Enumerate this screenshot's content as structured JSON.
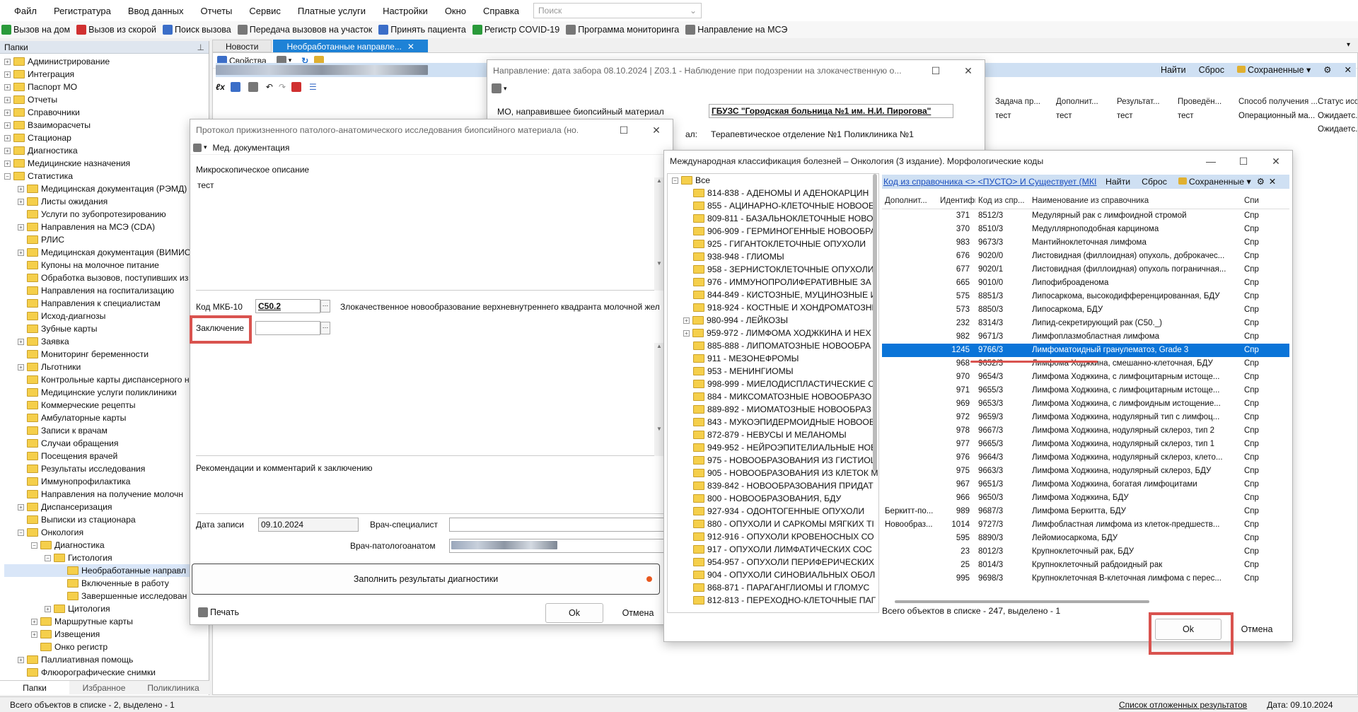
{
  "menu": [
    "Файл",
    "Регистратура",
    "Ввод данных",
    "Отчеты",
    "Сервис",
    "Платные услуги",
    "Настройки",
    "Окно",
    "Справка"
  ],
  "search": {
    "placeholder": "Поиск"
  },
  "toolbar": [
    {
      "label": "Вызов на дом",
      "icon": "home-call-icon",
      "color": "g"
    },
    {
      "label": "Вызов из скорой",
      "icon": "ambulance-call-icon",
      "color": "r"
    },
    {
      "label": "Поиск вызова",
      "icon": "search-call-icon",
      "color": "b"
    },
    {
      "label": "Передача вызовов на участок",
      "icon": "transfer-icon",
      "color": "gr"
    },
    {
      "label": "Принять пациента",
      "icon": "patient-icon",
      "color": "b"
    },
    {
      "label": "Регистр COVID-19",
      "icon": "covid-icon",
      "color": "g"
    },
    {
      "label": "Программа мониторинга",
      "icon": "monitoring-icon",
      "color": "gr"
    },
    {
      "label": "Направление на МСЭ",
      "icon": "mse-icon",
      "color": "gr"
    }
  ],
  "left": {
    "title": "Папки",
    "tree": [
      {
        "label": "Администрирование",
        "lvl": 0,
        "exp": "+"
      },
      {
        "label": "Интеграция",
        "lvl": 0,
        "exp": "+"
      },
      {
        "label": "Паспорт МО",
        "lvl": 0,
        "exp": "+"
      },
      {
        "label": "Отчеты",
        "lvl": 0,
        "exp": "+"
      },
      {
        "label": "Справочники",
        "lvl": 0,
        "exp": "+"
      },
      {
        "label": "Взаиморасчеты",
        "lvl": 0,
        "exp": "+"
      },
      {
        "label": "Стационар",
        "lvl": 0,
        "exp": "+"
      },
      {
        "label": "Диагностика",
        "lvl": 0,
        "exp": "+"
      },
      {
        "label": "Медицинские назначения",
        "lvl": 0,
        "exp": "+"
      },
      {
        "label": "Статистика",
        "lvl": 0,
        "exp": "−"
      },
      {
        "label": "Медицинская документация (РЭМД)",
        "lvl": 1,
        "exp": "+"
      },
      {
        "label": "Листы ожидания",
        "lvl": 1,
        "exp": "+"
      },
      {
        "label": "Услуги по зубопротезированию",
        "lvl": 1,
        "exp": ""
      },
      {
        "label": "Направления на МСЭ (CDA)",
        "lvl": 1,
        "exp": "+"
      },
      {
        "label": "РЛИС",
        "lvl": 1,
        "exp": ""
      },
      {
        "label": "Медицинская документация (ВИМИС)",
        "lvl": 1,
        "exp": "+"
      },
      {
        "label": "Купоны на молочное питание",
        "lvl": 1,
        "exp": ""
      },
      {
        "label": "Обработка вызовов, поступивших из",
        "lvl": 1,
        "exp": ""
      },
      {
        "label": "Направления на госпитализацию",
        "lvl": 1,
        "exp": ""
      },
      {
        "label": "Направления к специалистам",
        "lvl": 1,
        "exp": ""
      },
      {
        "label": "Исход-диагнозы",
        "lvl": 1,
        "exp": ""
      },
      {
        "label": "Зубные карты",
        "lvl": 1,
        "exp": ""
      },
      {
        "label": "Заявка",
        "lvl": 1,
        "exp": "+"
      },
      {
        "label": "Мониторинг беременности",
        "lvl": 1,
        "exp": ""
      },
      {
        "label": "Льготники",
        "lvl": 1,
        "exp": "+"
      },
      {
        "label": "Контрольные карты диспансерного н",
        "lvl": 1,
        "exp": ""
      },
      {
        "label": "Медицинские услуги поликлиники",
        "lvl": 1,
        "exp": ""
      },
      {
        "label": "Коммерческие рецепты",
        "lvl": 1,
        "exp": ""
      },
      {
        "label": "Амбулаторные карты",
        "lvl": 1,
        "exp": ""
      },
      {
        "label": "Записи к врачам",
        "lvl": 1,
        "exp": ""
      },
      {
        "label": "Случаи обращения",
        "lvl": 1,
        "exp": ""
      },
      {
        "label": "Посещения врачей",
        "lvl": 1,
        "exp": ""
      },
      {
        "label": "Результаты исследования",
        "lvl": 1,
        "exp": ""
      },
      {
        "label": "Иммунопрофилактика",
        "lvl": 1,
        "exp": ""
      },
      {
        "label": "Направления на получение молочн",
        "lvl": 1,
        "exp": ""
      },
      {
        "label": "Диспансеризация",
        "lvl": 1,
        "exp": "+"
      },
      {
        "label": "Выписки из стационара",
        "lvl": 1,
        "exp": ""
      },
      {
        "label": "Онкология",
        "lvl": 1,
        "exp": "−"
      },
      {
        "label": "Диагностика",
        "lvl": 2,
        "exp": "−"
      },
      {
        "label": "Гистология",
        "lvl": 3,
        "exp": "−"
      },
      {
        "label": "Необработанные направл",
        "lvl": 4,
        "exp": "",
        "sel": true
      },
      {
        "label": "Включенные в работу",
        "lvl": 4,
        "exp": ""
      },
      {
        "label": "Завершенные исследован",
        "lvl": 4,
        "exp": ""
      },
      {
        "label": "Цитология",
        "lvl": 3,
        "exp": "+"
      },
      {
        "label": "Маршрутные карты",
        "lvl": 2,
        "exp": "+"
      },
      {
        "label": "Извещения",
        "lvl": 2,
        "exp": "+"
      },
      {
        "label": "Онко регистр",
        "lvl": 2,
        "exp": ""
      },
      {
        "label": "Паллиативная помощь",
        "lvl": 1,
        "exp": "+"
      },
      {
        "label": "Флюорографические снимки",
        "lvl": 1,
        "exp": ""
      }
    ],
    "tabs": [
      "Папки",
      "Избранное",
      "Поликлиника"
    ]
  },
  "doc_tabs": [
    "Новости",
    "Необработанные направле..."
  ],
  "main": {
    "props_label": "Свойства",
    "find": "Найти",
    "reset": "Сброс",
    "saved": "Сохраненные",
    "right_cols": [
      "Задача пр...",
      "Дополнит...",
      "Результат...",
      "Проведён...",
      "Способ получения ...",
      "Статус исс"
    ],
    "right_rows": [
      [
        "тест",
        "тест",
        "тест",
        "тест",
        "Операционный ма...",
        "Ожидаетс."
      ],
      [
        "",
        "",
        "",
        "",
        "",
        "Ожидаетс."
      ]
    ]
  },
  "dir_win": {
    "title": "Направление: дата забора 08.10.2024 | Z03.1 - Наблюдение при подозрении на злокачественную о...",
    "mo_label": "МО, направившее биопсийный материал",
    "mo_value": "ГБУЗС \"Городская больница №1 им. Н.И. Пирогова\"",
    "dept_label": "ал:",
    "dept_value": "Терапевтическое отделение №1 Поликлиника №1"
  },
  "proto": {
    "title": "Протокол прижизненного патолого-анатомического исследования биопсийного материала (но...",
    "med_doc": "Мед. документация",
    "micro_label": "Микроскопическое описание",
    "micro_value": "тест",
    "mkb_label": "Код МКБ-10",
    "mkb_value": "C50.2",
    "mkb_desc": "Злокачественное новообразование верхневнутреннего квадранта молочной жел",
    "concl_label": "Заключение",
    "rec_label": "Рекомендации и комментарий к заключению",
    "date_label": "Дата записи",
    "date_value": "09.10.2024",
    "doc_spec_label": "Врач-специалист",
    "doc_path_label": "Врач-патологоанатом",
    "fill_btn": "Заполнить результаты диагностики",
    "print": "Печать",
    "ok": "Ok",
    "cancel": "Отмена"
  },
  "icd": {
    "title": "Международная классификация болезней – Онкология (3 издание). Морфологические коды",
    "filter": "Код из справочника <> <ПУСТО> И Существует (МКI",
    "find": "Найти",
    "reset": "Сброс",
    "saved": "Сохраненные",
    "tree_root": "Все",
    "tree": [
      "814-838 - АДЕНОМЫ И АДЕНОКАРЦИН",
      "855 - АЦИНАРНО-КЛЕТОЧНЫЕ НОВООБ",
      "809-811 - БАЗАЛЬНОКЛЕТОЧНЫЕ НОВО",
      "906-909 - ГЕРМИНОГЕННЫЕ НОВООБРА",
      "925 - ГИГАНТОКЛЕТОЧНЫЕ ОПУХОЛИ",
      "938-948 - ГЛИОМЫ",
      "958 - ЗЕРНИСТОКЛЕТОЧНЫЕ ОПУХОЛИ",
      "976 - ИММУНОПРОЛИФЕРАТИВНЫЕ ЗА",
      "844-849 - КИСТОЗНЫЕ, МУЦИНОЗНЫЕ И",
      "918-924 - КОСТНЫЕ И ХОНДРОМАТОЗНЬ",
      "980-994 - ЛЕЙКОЗЫ",
      "959-972 - ЛИМФОМА ХОДЖКИНА И НЕХ",
      "885-888 - ЛИПОМАТОЗНЫЕ НОВООБРА",
      "911 - МЕЗОНЕФРОМЫ",
      "953 - МЕНИНГИОМЫ",
      "998-999 - МИЕЛОДИСПЛАСТИЧЕСКИЕ С",
      "884 - МИКСОМАТОЗНЫЕ НОВООБРАЗО",
      "889-892 - МИОМАТОЗНЫЕ НОВООБРАЗ",
      "843 - МУКОЭПИДЕРМОИДНЫЕ НОВООБ",
      "872-879 - НЕВУСЫ И МЕЛАНОМЫ",
      "949-952 - НЕЙРОЭПИТЕЛИАЛЬНЫЕ НОВ",
      "975 - НОВООБРАЗОВАНИЯ ИЗ ГИСТИОЦ",
      "905 - НОВООБРАЗОВАНИЯ ИЗ КЛЕТОК М",
      "839-842 - НОВООБРАЗОВАНИЯ ПРИДАТ",
      "800 - НОВООБРАЗОВАНИЯ, БДУ",
      "927-934 - ОДОНТОГЕННЫЕ ОПУХОЛИ",
      "880 - ОПУХОЛИ И САРКОМЫ МЯГКИХ ТІ",
      "912-916 - ОПУХОЛИ КРОВЕНОСНЫХ СО",
      "917 - ОПУХОЛИ ЛИМФАТИЧЕСКИХ СОС",
      "954-957 - ОПУХОЛИ ПЕРИФЕРИЧЕСКИХ",
      "904 - ОПУХОЛИ СИНОВИАЛЬНЫХ ОБОЛ",
      "868-871 - ПАРАГАНГЛИОМЫ И ГЛОМУС",
      "812-813 - ПЕРЕХОДНО-КЛЕТОЧНЫЕ ПАГ"
    ],
    "cols": [
      "Дополнит...",
      "Идентифи...",
      "Код из спр...",
      "Наименование из справочника",
      "Спи"
    ],
    "rows": [
      [
        "",
        "371",
        "8512/3",
        "Медулярный рак с лимфоидной стромой",
        "Спр"
      ],
      [
        "",
        "370",
        "8510/3",
        "Медуллярноподобная карцинома",
        "Спр"
      ],
      [
        "",
        "983",
        "9673/3",
        "Мантийноклеточная лимфома",
        "Спр"
      ],
      [
        "",
        "676",
        "9020/0",
        "Листовидная (филлоидная) опухоль, доброкачес...",
        "Спр"
      ],
      [
        "",
        "677",
        "9020/1",
        "Листовидная (филлоидная) опухоль пограничная...",
        "Спр"
      ],
      [
        "",
        "665",
        "9010/0",
        "Липофиброаденома",
        "Спр"
      ],
      [
        "",
        "575",
        "8851/3",
        "Липосаркома, высокодифференцированная, БДУ",
        "Спр"
      ],
      [
        "",
        "573",
        "8850/3",
        "Липосаркома, БДУ",
        "Спр"
      ],
      [
        "",
        "232",
        "8314/3",
        "Липид-секретирующий рак (C50._)",
        "Спр"
      ],
      [
        "",
        "982",
        "9671/3",
        "Лимфоплазмобластная лимфома",
        "Спр"
      ],
      [
        "",
        "1245",
        "9766/3",
        "Лимфоматоидный гранулематоз, Grade 3",
        "Спр"
      ],
      [
        "",
        "968",
        "9652/3",
        "Лимфома Ходжкина, смешанно-клеточная, БДУ",
        "Спр"
      ],
      [
        "",
        "970",
        "9654/3",
        "Лимфома Ходжкина, с лимфоцитарным истоще...",
        "Спр"
      ],
      [
        "",
        "971",
        "9655/3",
        "Лимфома Ходжкина, с лимфоцитарным истоще...",
        "Спр"
      ],
      [
        "",
        "969",
        "9653/3",
        "Лимфома Ходжкина, с лимфоидным истощение...",
        "Спр"
      ],
      [
        "",
        "972",
        "9659/3",
        "Лимфома Ходжкина, нодулярный тип с лимфоц...",
        "Спр"
      ],
      [
        "",
        "978",
        "9667/3",
        "Лимфома Ходжкина, нодулярный склероз, тип 2",
        "Спр"
      ],
      [
        "",
        "977",
        "9665/3",
        "Лимфома Ходжкина, нодулярный склероз, тип 1",
        "Спр"
      ],
      [
        "",
        "976",
        "9664/3",
        "Лимфома Ходжкина, нодулярный склероз, клето...",
        "Спр"
      ],
      [
        "",
        "975",
        "9663/3",
        "Лимфома Ходжкина, нодулярный склероз, БДУ",
        "Спр"
      ],
      [
        "",
        "967",
        "9651/3",
        "Лимфома Ходжкина, богатая лимфоцитами",
        "Спр"
      ],
      [
        "",
        "966",
        "9650/3",
        "Лимфома Ходжкина, БДУ",
        "Спр"
      ],
      [
        "Беркитт-по...",
        "989",
        "9687/3",
        "Лимфома Беркитта, БДУ",
        "Спр"
      ],
      [
        "Новообраз...",
        "1014",
        "9727/3",
        "Лимфобластная лимфома из клеток-предшеств...",
        "Спр"
      ],
      [
        "",
        "595",
        "8890/3",
        "Лейомиосаркома, БДУ",
        "Спр"
      ],
      [
        "",
        "23",
        "8012/3",
        "Крупноклеточный рак, БДУ",
        "Спр"
      ],
      [
        "",
        "25",
        "8014/3",
        "Крупноклеточный рабдоидный рак",
        "Спр"
      ],
      [
        "",
        "995",
        "9698/3",
        "Крупноклеточная В-клеточная лимфома с перес...",
        "Спр"
      ]
    ],
    "footer": "Всего объектов в списке - 247, выделено - 1",
    "ok": "Ok",
    "cancel": "Отмена"
  },
  "status": {
    "left": "Всего объектов в списке - 2, выделено - 1",
    "link": "Список отложенных результатов",
    "date": "Дата: 09.10.2024"
  }
}
